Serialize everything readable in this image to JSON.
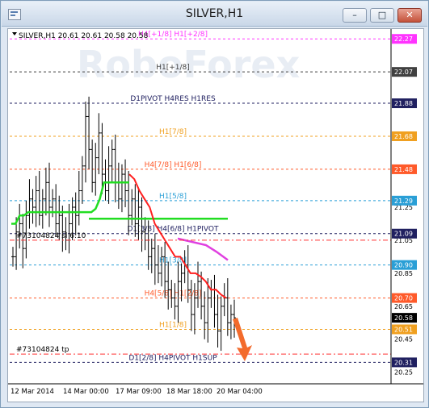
{
  "window": {
    "title": "SILVER,H1"
  },
  "chart_data": {
    "type": "candlestick",
    "header": "SILVER,H1  20.61 20.61 20.58 20.58",
    "watermark": "RoboForex",
    "ylim": [
      20.18,
      22.32
    ],
    "price_ticks": [
      "22.07",
      "21.88",
      "21.68",
      "21.48",
      "21.29",
      "21.09",
      "20.90",
      "20.70",
      "20.51",
      "20.31"
    ],
    "minor_ticks": [
      "21.25",
      "21.05",
      "20.85",
      "20.65",
      "20.45",
      "20.25"
    ],
    "last_price": "20.58",
    "time_labels": [
      "12 Mar 2014",
      "14 Mar 00:00",
      "17 Mar 09:00",
      "18 Mar 18:00",
      "20 Mar 04:00"
    ],
    "levels": [
      {
        "price": 22.27,
        "label": "H4[+1/8] H1[+2/8]",
        "tag": "22.27",
        "color": "#ff33ff"
      },
      {
        "price": 22.07,
        "label": "H1[+1/8]",
        "tag": "22.07",
        "color": "#404040"
      },
      {
        "price": 21.88,
        "label": "D1PIVOT H4RES H1RES",
        "tag": "21.88",
        "color": "#202060"
      },
      {
        "price": 21.68,
        "label": "H1[7/8]",
        "tag": "21.68",
        "color": "#f0a020"
      },
      {
        "price": 21.48,
        "label": "H4[7/8] H1[6/8]",
        "tag": "21.48",
        "color": "#ff5a2a"
      },
      {
        "price": 21.29,
        "label": "H1[5/8]",
        "tag": "21.29",
        "color": "#2a9fd6"
      },
      {
        "price": 21.09,
        "label": "D1[3/8] H4[6/8] H1PIVOT",
        "tag": "21.09",
        "color": "#202060"
      },
      {
        "price": 20.9,
        "label": "H1[3/8]",
        "tag": "20.90",
        "color": "#2a9fd6"
      },
      {
        "price": 20.7,
        "label": "H4[5/8] H1[2/8]",
        "tag": "20.70",
        "color": "#ff5a2a"
      },
      {
        "price": 20.51,
        "label": "H1[1/8]",
        "tag": "20.51",
        "color": "#f0a020"
      },
      {
        "price": 20.31,
        "label": "D1[2/8] H4PIVOT H1SUP",
        "tag": "20.31",
        "color": "#202060"
      }
    ],
    "orders": [
      {
        "label": "#73104824 sl",
        "value": "6.10",
        "price": 21.05
      },
      {
        "label": "#73104824 tp",
        "price": 20.36
      }
    ],
    "close_series": [
      20.95,
      21.1,
      21.15,
      21.0,
      21.2,
      21.3,
      21.25,
      21.35,
      21.2,
      21.3,
      21.4,
      21.25,
      21.3,
      21.15,
      21.2,
      21.1,
      21.05,
      21.15,
      21.25,
      21.2,
      21.35,
      21.5,
      21.8,
      21.6,
      21.4,
      21.55,
      21.7,
      21.45,
      21.35,
      21.5,
      21.6,
      21.4,
      21.3,
      21.45,
      21.35,
      21.2,
      21.3,
      21.15,
      21.25,
      21.1,
      21.05,
      20.95,
      21.0,
      20.9,
      20.85,
      20.95,
      20.8,
      20.75,
      20.7,
      20.65,
      20.8,
      20.85,
      20.9,
      20.75,
      20.6,
      20.7,
      20.8,
      20.65,
      20.55,
      20.7,
      20.75,
      20.6,
      20.5,
      20.65,
      20.7,
      20.55,
      20.6,
      20.58
    ],
    "green_line": [
      21.15,
      21.15,
      21.2,
      21.2,
      21.22,
      21.22,
      21.22,
      21.22,
      21.22,
      21.22,
      21.22,
      21.22,
      21.22,
      21.22,
      21.22,
      21.22,
      21.22,
      21.22,
      21.22,
      21.22,
      21.24,
      21.3,
      21.4,
      21.4,
      21.4,
      21.4,
      21.4,
      21.4,
      21.4
    ],
    "green_line2": [
      21.18,
      21.18,
      21.18,
      21.18,
      21.18,
      21.18,
      21.18
    ],
    "red_line": [
      21.45,
      21.42,
      21.35,
      21.3,
      21.25,
      21.15,
      21.1,
      21.05,
      21.0,
      20.95,
      20.95,
      20.9,
      20.85,
      20.85,
      20.83,
      20.8,
      20.75,
      20.75,
      20.72,
      20.7
    ]
  }
}
